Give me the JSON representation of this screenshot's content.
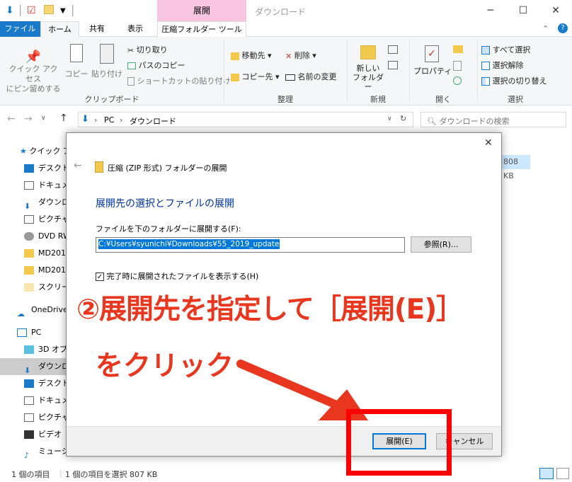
{
  "window": {
    "title": "ダウンロード",
    "context_tab_group": "展開",
    "minimize": "─",
    "maximize": "☐",
    "close": "✕"
  },
  "ribbon_tabs": {
    "file": "ファイル",
    "home": "ホーム",
    "share": "共有",
    "view": "表示",
    "compressed_tools": "圧縮フォルダー ツール"
  },
  "ribbon": {
    "clipboard": {
      "pin": "クイック アクセス\nにピン留めする",
      "copy": "コピー",
      "paste": "貼り付け",
      "cut": "切り取り",
      "copy_path": "パスのコピー",
      "paste_shortcut": "ショートカットの貼り付け",
      "label": "クリップボード"
    },
    "organize": {
      "move_to": "移動先",
      "copy_to": "コピー先",
      "delete": "削除",
      "rename": "名前の変更",
      "label": "整理"
    },
    "new": {
      "new_folder": "新しい\nフォルダー",
      "label": "新規"
    },
    "open": {
      "properties": "プロパティ",
      "label": "開く"
    },
    "select": {
      "select_all": "すべて選択",
      "select_none": "選択解除",
      "invert": "選択の切り替え",
      "label": "選択"
    }
  },
  "address": {
    "crumb_pc": "PC",
    "crumb_downloads": "ダウンロード",
    "search_placeholder": "ダウンロードの検索"
  },
  "nav": {
    "quick_access": "クイック アクセス",
    "items": [
      "デスクトップ",
      "ドキュメント",
      "ダウンロード",
      "ピクチャ",
      "DVD RW",
      "MD2018",
      "MD2019",
      "スクリーン",
      "OneDrive",
      "PC",
      "3D オブジェクト",
      "ダウンロード",
      "デスクトップ",
      "ドキュメント",
      "ピクチャ",
      "ビデオ",
      "ミュージック"
    ]
  },
  "file_size_behind": "808 KB",
  "status": {
    "item_count": "1 個の項目",
    "selected": "1 個の項目を選択  807 KB"
  },
  "dialog": {
    "title": "圧縮 (ZIP 形式) フォルダーの展開",
    "heading": "展開先の選択とファイルの展開",
    "field_label": "ファイルを下のフォルダーに展開する(F):",
    "path_value": "C:¥Users¥syunichi¥Downloads¥55_2019_update",
    "browse": "参照(R)...",
    "checkbox_label": "完了時に展開されたファイルを表示する(H)",
    "checkbox_checked": true,
    "extract": "展開(E)",
    "cancel": "キャンセル"
  },
  "annotation": {
    "line1": "②展開先を指定して［展開(E)］",
    "line2": "をクリック",
    "color": "#e8361f"
  }
}
